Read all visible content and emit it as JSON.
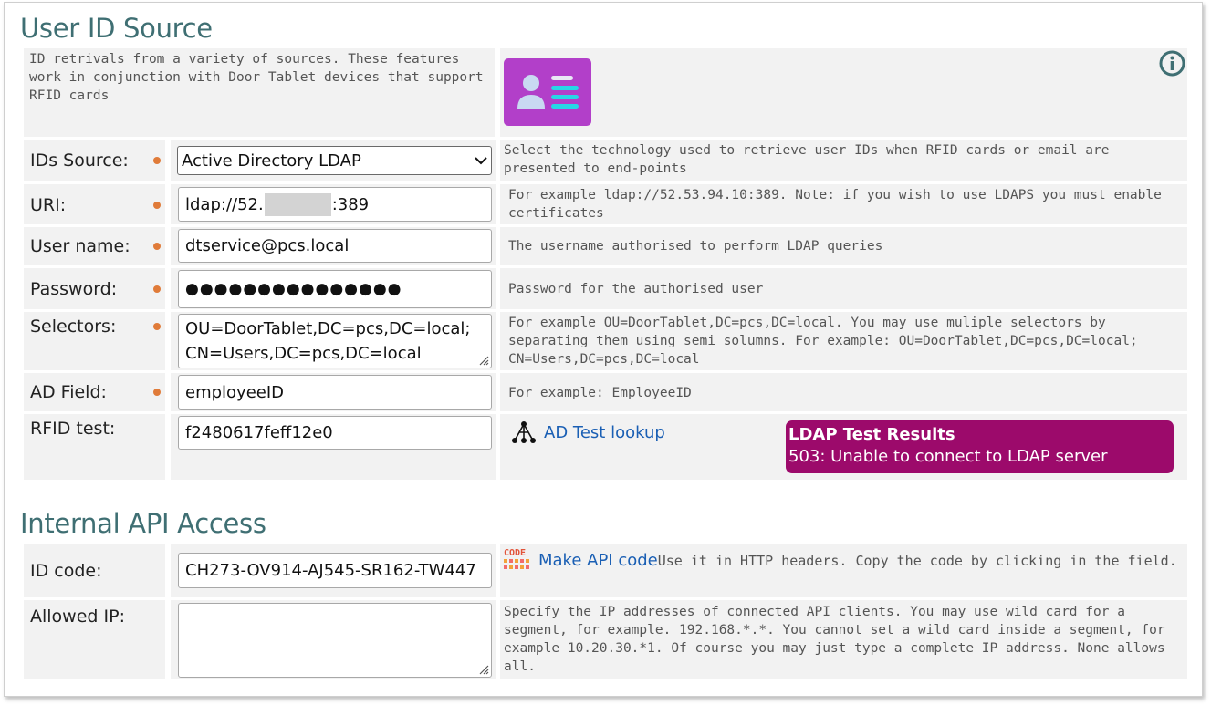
{
  "sections": {
    "user_id_source": "User ID Source",
    "internal_api": "Internal API Access"
  },
  "intro": {
    "text": "ID retrivals from a variety of sources.  These features work in conjunction with Door Tablet devices that support RFID cards"
  },
  "rows": {
    "ids_source": {
      "label": "IDs Source:",
      "value": "Active Directory LDAP",
      "help": "Select the technology used to retrieve user IDs when RFID cards or email are presented to end-points"
    },
    "uri": {
      "label": "URI:",
      "value_start": "ldap://52.",
      "value_end": ":389",
      "help": "For example ldap://52.53.94.10:389. Note: if you wish to use LDAPS you must enable certificates"
    },
    "username": {
      "label": "User name:",
      "value": "dtservice@pcs.local",
      "help": "The username authorised to perform LDAP queries"
    },
    "password": {
      "label": "Password:",
      "value": "●●●●●●●●●●●●●●●",
      "help": "Password for the authorised user"
    },
    "selectors": {
      "label": "Selectors:",
      "line1": "OU=DoorTablet,DC=pcs,DC=local;",
      "line2": "CN=Users,DC=pcs,DC=local",
      "help": "For example OU=DoorTablet,DC=pcs,DC=local.  You may use muliple selectors by separating them using semi solumns.  For example: OU=DoorTablet,DC=pcs,DC=local; CN=Users,DC=pcs,DC=local"
    },
    "ad_field": {
      "label": "AD Field:",
      "value": "employeeID",
      "help": "For example: EmployeeID"
    },
    "rfid_test": {
      "label": "RFID test:",
      "value": "f2480617feff12e0",
      "lookup_label": "AD Test lookup",
      "result_title": "LDAP Test Results",
      "result_message": "503: Unable to connect to LDAP server"
    },
    "id_code": {
      "label": "ID code:",
      "value": "CH273-OV914-AJ545-SR162-TW447",
      "make_label": "Make API code",
      "help": "Use it in HTTP headers. Copy the code by clicking in the field.",
      "badge": "CODE"
    },
    "allowed_ip": {
      "label": "Allowed IP:",
      "value": "",
      "help": "Specify the IP addresses of connected API clients. You may use wild card for a segment, for example. 192.168.*.*. You cannot set a wild card inside a segment, for example 10.20.30.*1. Of course you may just type a complete IP address. None allows all."
    }
  },
  "colors": {
    "title": "#3f6f73",
    "required_dot": "#e07b39",
    "result_bg": "#9c0a6b",
    "link": "#1a5fb4",
    "card_icon_bg": "#b23fc9"
  }
}
